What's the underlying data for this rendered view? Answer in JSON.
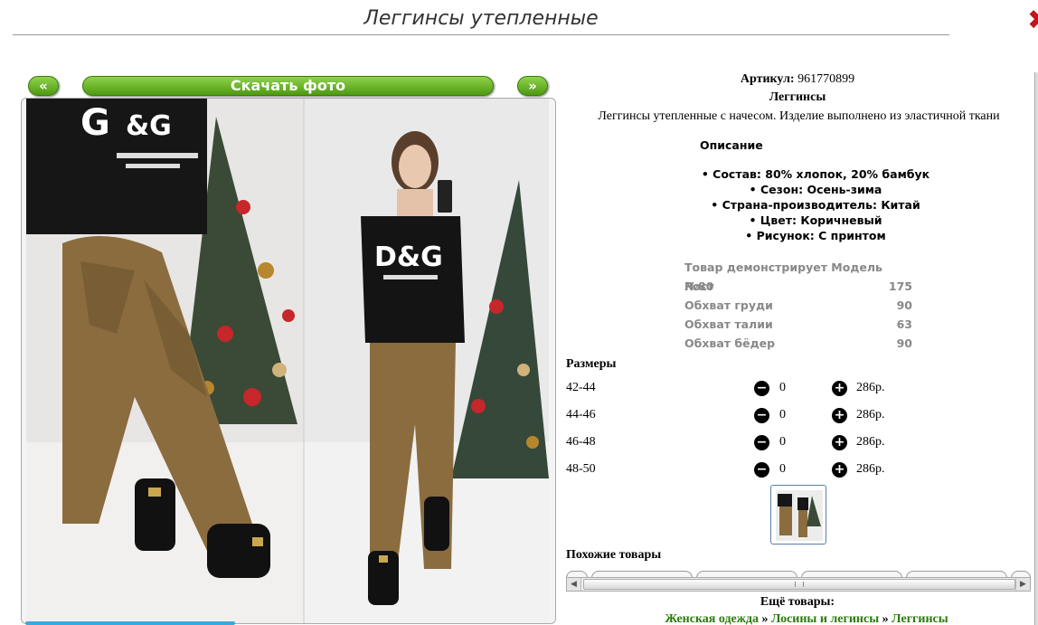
{
  "title": "Леггинсы утепленные",
  "nav": {
    "prev": "«",
    "download": "Скачать фото",
    "next": "»"
  },
  "close": "✖",
  "product": {
    "article_label": "Артикул:",
    "article_value": "961770899",
    "kind": "Леггинсы",
    "description": "Леггинсы утепленные с начесом. Изделие выполнено из эластичной ткани",
    "description_head": "Описание",
    "properties": [
      "• Состав: 80% хлопок, 20% бамбук",
      "• Сезон: Осень-зима",
      "• Страна-производитель: Китай",
      "• Цвет: Коричневый",
      "• Рисунок: С принтом"
    ]
  },
  "model": {
    "header": "Товар демонстрирует Модель №80",
    "rows": [
      {
        "label": "Рост",
        "value": "175"
      },
      {
        "label": "Обхват груди",
        "value": "90"
      },
      {
        "label": "Обхват талии",
        "value": "63"
      },
      {
        "label": "Обхват бёдер",
        "value": "90"
      }
    ]
  },
  "sizes": {
    "header": "Размеры",
    "rows": [
      {
        "size": "42-44",
        "qty": "0",
        "price": "286р."
      },
      {
        "size": "44-46",
        "qty": "0",
        "price": "286р."
      },
      {
        "size": "46-48",
        "qty": "0",
        "price": "286р."
      },
      {
        "size": "48-50",
        "qty": "0",
        "price": "286р."
      }
    ],
    "minus": "−",
    "plus": "+"
  },
  "similar": {
    "header": "Похожие товары"
  },
  "more": {
    "header": "Ещё товары:",
    "crumbs": [
      "Женская одежда",
      "Лосины и легинсы",
      "Леггинсы"
    ],
    "sep": " » "
  },
  "colors": {
    "accent_green": "#4e9a12",
    "link_green": "#2b7a0b",
    "close_red": "#c0161c"
  }
}
